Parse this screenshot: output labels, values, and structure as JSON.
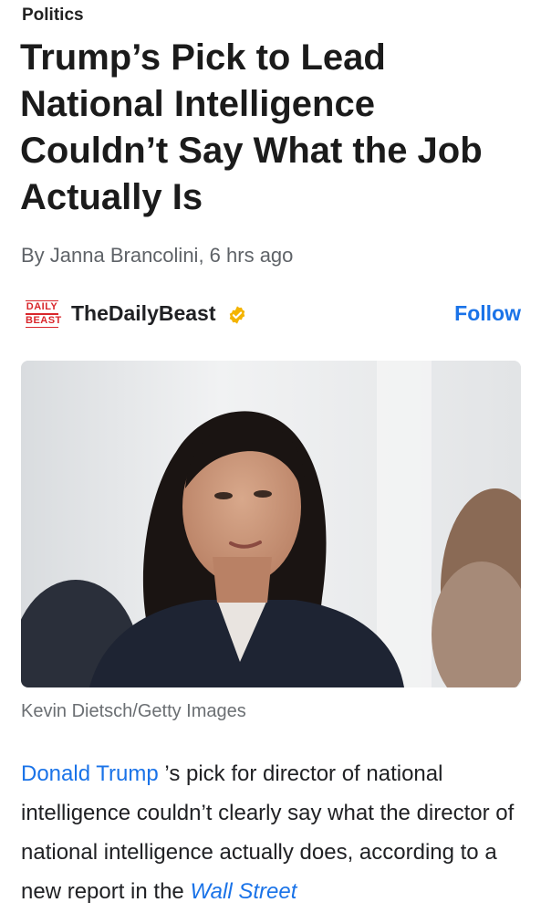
{
  "article": {
    "category": "Politics",
    "headline": "Trump’s Pick to Lead National Intelligence Couldn’t Say What the Job Actually Is",
    "byline": "By Janna Brancolini, 6 hrs ago"
  },
  "publisher": {
    "logo_line1": "DAILY",
    "logo_line2": "BEAST",
    "name": "TheDailyBeast",
    "verified_icon": "verified-badge-icon",
    "follow_label": "Follow"
  },
  "image": {
    "caption": "Kevin Dietsch/Getty Images"
  },
  "body": {
    "link_text": "Donald Trump",
    "text_1": " ’s pick for director of national intelligence couldn’t clearly say what the director of national intelligence actually does, according to a new report in the ",
    "link_italic_text": "Wall Street"
  },
  "colors": {
    "link": "#1a73e8",
    "logo_red": "#d9262b",
    "verified_gold": "#f4b400"
  }
}
